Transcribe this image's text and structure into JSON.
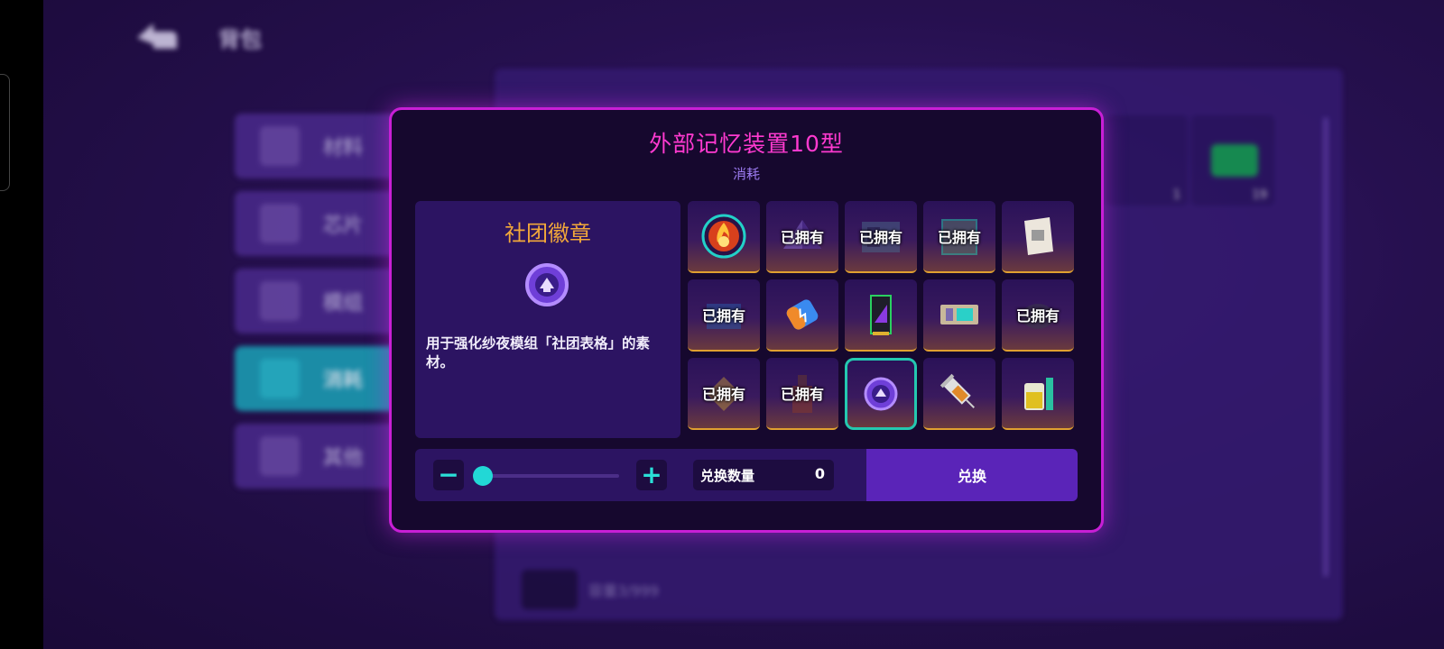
{
  "background": {
    "title": "背包",
    "sidebar": [
      {
        "label": "材料",
        "active": false
      },
      {
        "label": "芯片",
        "active": false
      },
      {
        "label": "模组",
        "active": false
      },
      {
        "label": "消耗",
        "active": true
      },
      {
        "label": "其他",
        "active": false
      }
    ],
    "slot_counts": [
      "1",
      "19"
    ],
    "capacity": "容量3/999"
  },
  "modal": {
    "title": "外部记忆装置10型",
    "category": "消耗",
    "selected_item": {
      "name": "社团徽章",
      "description": "用于强化纱夜模组「社团表格」的素材。",
      "icon": "club-badge-icon"
    },
    "owned_label": "已拥有",
    "items": [
      {
        "icon": "fire-emblem-icon",
        "owned": false
      },
      {
        "icon": "pyramid-icon",
        "owned": true
      },
      {
        "icon": "card-reader-icon",
        "owned": true
      },
      {
        "icon": "circuit-panel-icon",
        "owned": true
      },
      {
        "icon": "paper-note-icon",
        "owned": false
      },
      {
        "icon": "blue-book-icon",
        "owned": true
      },
      {
        "icon": "battery-capsule-icon",
        "owned": false
      },
      {
        "icon": "purple-chip-icon",
        "owned": false
      },
      {
        "icon": "memory-card-icon",
        "owned": false
      },
      {
        "icon": "dark-bug-icon",
        "owned": true
      },
      {
        "icon": "gold-diamond-icon",
        "owned": true
      },
      {
        "icon": "bottle-icon",
        "owned": true
      },
      {
        "icon": "club-badge-icon",
        "owned": false,
        "selected": true
      },
      {
        "icon": "syringe-icon",
        "owned": false
      },
      {
        "icon": "potion-jar-icon",
        "owned": false
      }
    ],
    "quantity": {
      "label": "兑换数量",
      "value": "0",
      "minus": "−",
      "plus": "+",
      "slider_fraction": 0
    },
    "exchange_label": "兑换"
  },
  "colors": {
    "accent_magenta": "#c81fd6",
    "title_pink": "#ff3ad0",
    "item_name_orange": "#f2a83a",
    "teal": "#22d8d6"
  }
}
